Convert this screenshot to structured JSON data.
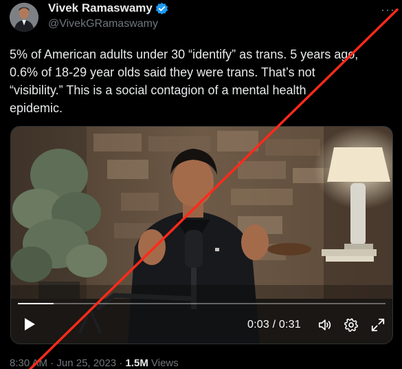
{
  "author": {
    "display_name": "Vivek Ramaswamy",
    "handle": "@VivekGRamaswamy",
    "verified": true,
    "verified_color": "#1d9bf0"
  },
  "more_label": "···",
  "tweet": {
    "text": "5% of American adults under 30 “identify” as trans. 5 years ago,\n0.6% of 18-29 year olds said they were trans. That’s not\n“visibility.” This is a social contagion of a mental health\nepidemic."
  },
  "video": {
    "time_label": "0:03 / 0:31",
    "progress_fraction": 0.097,
    "icons": [
      "play-icon",
      "volume-icon",
      "settings-icon",
      "fullscreen-icon"
    ]
  },
  "meta": {
    "time": "8:30 AM",
    "separator": "·",
    "date": "Jun 25, 2023",
    "views_count": "1.5M",
    "views_label": "Views"
  },
  "overlay": {
    "strike_color": "#ff2a1a"
  },
  "colors": {
    "background": "#000000",
    "text": "#e7e9ea",
    "muted": "#71767b"
  }
}
